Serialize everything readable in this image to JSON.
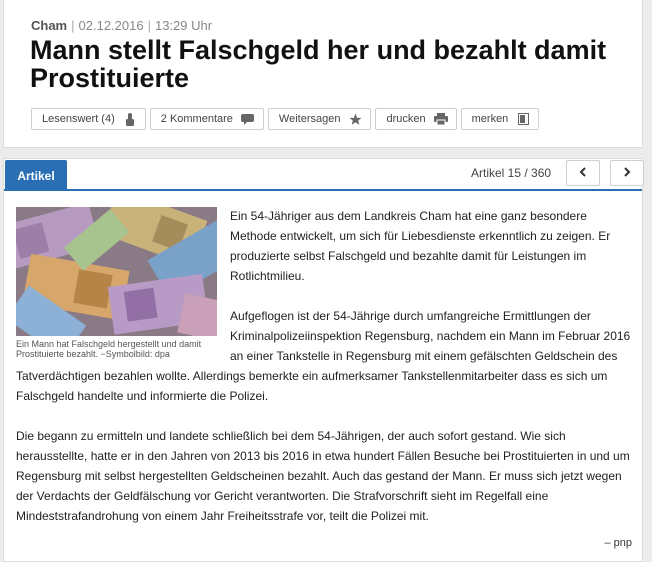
{
  "meta": {
    "city": "Cham",
    "date": "02.12.2016",
    "time": "13:29 Uhr"
  },
  "headline": "Mann stellt Falschgeld her und bezahlt damit Prostituierte",
  "actions": [
    {
      "label": "Lesenswert (4)",
      "icon": "thumbs-up-icon"
    },
    {
      "label": "2 Kommentare",
      "icon": "comment-icon"
    },
    {
      "label": "Weitersagen",
      "icon": "star-icon"
    },
    {
      "label": "drucken",
      "icon": "printer-icon"
    },
    {
      "label": "merken",
      "icon": "bookmark-icon"
    }
  ],
  "tabs": {
    "active": "Artikel"
  },
  "pagination": {
    "counter": "Artikel 15 / 360",
    "prev": "‹",
    "next": "›"
  },
  "figure": {
    "caption": "Ein Mann hat Falschgeld hergestellt und damit Prostituierte bezahlt. −Symbolbild: dpa"
  },
  "body": {
    "paragraphs": [
      "Ein 54-Jähriger aus dem Landkreis Cham hat eine ganz besondere Methode entwickelt, um sich für Liebesdienste erkenntlich zu zeigen. Er produzierte selbst Falschgeld und bezahlte damit für Leistungen im Rotlichtmilieu.",
      "Aufgeflogen ist der 54-Jährige durch umfangreiche Ermittlungen der Kriminalpolizeiinspektion Regensburg, nachdem ein Mann im Februar 2016 an einer Tankstelle in Regensburg mit einem gefälschten Geldschein des Tatverdächtigen bezahlen wollte. Allerdings bemerkte ein aufmerksamer Tankstellenmitarbeiter dass es sich um Falschgeld handelte und informierte die Polizei.",
      "Die begann zu ermitteln und landete schließlich bei dem 54-Jährigen, der auch sofort gestand. Wie sich herausstellte, hatte er in den Jahren von 2013 bis 2016 in etwa hundert Fällen Besuche bei Prostituierten in und um Regensburg mit selbst hergestellten Geldscheinen bezahlt. Auch das gestand der Mann. Er muss sich jetzt wegen der Verdachts der Geldfälschung vor Gericht verantworten. Die Strafvorschrift sieht im Regelfall eine Mindeststrafandrohung von einem Jahr Freiheitsstrafe vor, teilt die Polizei mit."
    ],
    "author": "– pnp"
  },
  "colors": {
    "accent": "#2a6eb4",
    "background": "#ececec"
  }
}
